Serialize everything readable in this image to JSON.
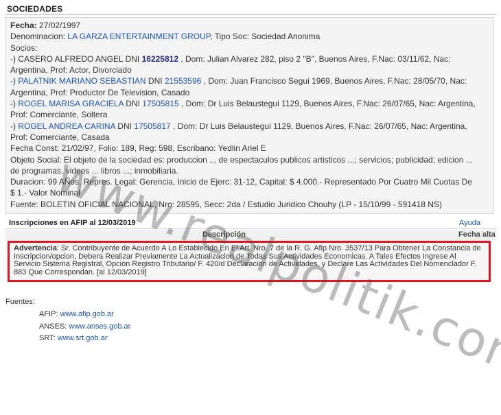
{
  "section_title": "SOCIEDADES",
  "record": {
    "fecha_label": "Fecha:",
    "fecha_value": "27/02/1997",
    "denominacion_label": "Denominacion:",
    "company_name": "LA GARZA ENTERTAINMENT GROUP",
    "tipo_soc": ", Tipo Soc: Sociedad Anonima",
    "socios_label": "Socios:",
    "socios": [
      {
        "prefix": "-) ",
        "name": "CASERO ALFREDO ANGEL",
        "name_link": false,
        "dni_label": " DNI ",
        "dni": "16225812",
        "dni_style": "dark",
        "line1": " , Dom: Julian Alvarez 282, piso 2 \"B\", Buenos Aires, F.Nac: 03/11/62, Nac:",
        "line2": "Argentina, Prof: Actor, Divorciado"
      },
      {
        "prefix": "-) ",
        "name": "PALATNIK MARIANO SEBASTIAN",
        "name_link": true,
        "dni_label": " DNI ",
        "dni": "21553596",
        "dni_style": "link",
        "line1": " , Dom: Juan Francisco Segui 1969, Buenos Aires, F.Nac: 28/05/70, Nac:",
        "line2": "Argentina, Prof: Productor De Television, Casado"
      },
      {
        "prefix": "-) ",
        "name": "ROGEL MARISA GRACIELA",
        "name_link": true,
        "dni_label": " DNI ",
        "dni": "17505815",
        "dni_style": "link",
        "line1": " , Dom: Dr Luis Belaustegui 1129, Buenos Aires, F.Nac: 26/07/65, Nac: Argentina,",
        "line2": "Prof: Comerciante, Soltera"
      },
      {
        "prefix": "-) ",
        "name": "ROGEL ANDREA CARINA",
        "name_link": true,
        "dni_label": " DNI ",
        "dni": "17505817",
        "dni_style": "link",
        "line1": " , Dom: Dr Luis Belaustegui 1129, Buenos Aires, F.Nac: 26/07/65, Nac: Argentina,",
        "line2": "Prof: Comerciante, Casada"
      }
    ],
    "fecha_const": "Fecha Const: 21/02/97, Folio: 189, Reg: 598, Escribano: Yedlin Ariel E",
    "objeto_1": "Objeto Social: El objeto de la sociedad es: produccion ... de espectaculos publicos artisticos ...; servicios; publicidad; edicion ...",
    "objeto_2": "de programas, videos ... libros ...; inmobiliaria.",
    "duracion_1": "Duracion: 99 AÑos, Repres. Legal: Gerencia, Inicio de Ejerc: 31-12, Capital: $ 4.000.- Representado Por Cuatro Mil Cuotas De",
    "duracion_2": "$ 1.- Valor Nominal",
    "fuente": "Fuente: BOLETIN OFICIAL NACIONAL, Nro: 28595, Secc: 2da / Estudio Juridico Chouhy (LP - 15/10/99 - 591418 NS)"
  },
  "afip": {
    "heading": "Inscripciones en AFIP al 12/03/2019",
    "help_link": "Ayuda",
    "col_description": "Descripción",
    "col_fecha": "Fecha alta",
    "warning_label": "Advertencia",
    "warning_text": ": Sr. Contribuyente de Acuerdo A Lo Establecido En El Art. Nro. 7 de la R. G. Afip Nro. 3537/13 Para Obtener La Constancia de Inscripcion/opcion, Debera Realizar Previamente La Actualizacion de Todas Sus Actividades Economicas. A Tales Efectos Ingrese Al Servicio Sistema Registral, Opcion Registro Tributario/ F. 420/d Declaracion de Actividades, y Declare Las Actividades Del Nomenclador F. 883 Que Correspondan. [al 12/03/2019]"
  },
  "fuentes": {
    "label": "Fuentes:",
    "items": [
      {
        "name": "AFIP:",
        "url": "www.afip.gob.ar"
      },
      {
        "name": "ANSES:",
        "url": "www.anses.gob.ar"
      },
      {
        "name": "SRT:",
        "url": "www.srt.gob.ar"
      }
    ]
  },
  "watermark": "www.realpolitik.com.ar",
  "colors": {
    "link": "#1a54c6",
    "highlight_border": "#e8131c"
  }
}
